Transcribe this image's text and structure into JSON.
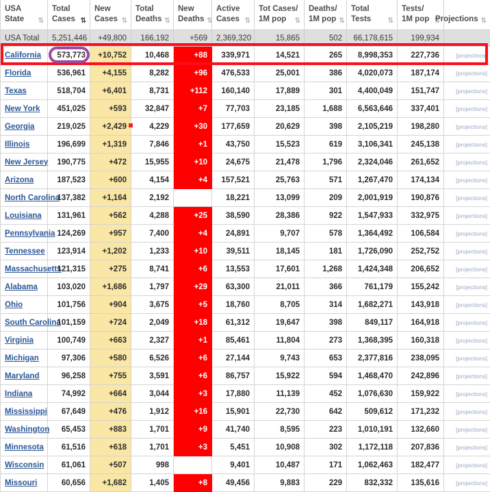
{
  "table": {
    "columns": [
      {
        "key": "state",
        "line1": "USA",
        "line2": "State",
        "sort_icon": "sort-both-icon",
        "sort_active": false
      },
      {
        "key": "totcases",
        "line1": "Total",
        "line2": "Cases",
        "sort_icon": "sort-desc-icon",
        "sort_active": true
      },
      {
        "key": "newcases",
        "line1": "New",
        "line2": "Cases",
        "sort_icon": "sort-both-icon",
        "sort_active": false
      },
      {
        "key": "totdeaths",
        "line1": "Total",
        "line2": "Deaths",
        "sort_icon": "sort-both-icon",
        "sort_active": false
      },
      {
        "key": "newdeaths",
        "line1": "New",
        "line2": "Deaths",
        "sort_icon": "sort-both-icon",
        "sort_active": false
      },
      {
        "key": "active",
        "line1": "Active",
        "line2": "Cases",
        "sort_icon": "sort-both-icon",
        "sort_active": false
      },
      {
        "key": "cases1m",
        "line1": "Tot Cases/",
        "line2": "1M pop",
        "sort_icon": "sort-both-icon",
        "sort_active": false
      },
      {
        "key": "deaths1m",
        "line1": "Deaths/",
        "line2": "1M pop",
        "sort_icon": "sort-both-icon",
        "sort_active": false
      },
      {
        "key": "tottests",
        "line1": "Total",
        "line2": "Tests",
        "sort_icon": "sort-both-icon",
        "sort_active": false
      },
      {
        "key": "tests1m",
        "line1": "Tests/",
        "line2": "1M pop",
        "sort_icon": "sort-both-icon",
        "sort_active": false
      },
      {
        "key": "proj",
        "line1": "",
        "line2": "Projections",
        "sort_icon": "sort-both-icon",
        "sort_active": false
      }
    ],
    "projections_link_label": "[projections]",
    "total_row": {
      "state": "USA Total",
      "totcases": "5,251,446",
      "newcases": "+49,800",
      "totdeaths": "166,192",
      "newdeaths": "+569",
      "active": "2,369,320",
      "cases1m": "15,865",
      "deaths1m": "502",
      "tottests": "66,178,615",
      "tests1m": "199,934",
      "proj": ""
    },
    "rows": [
      {
        "state": "California",
        "totcases": "573,773",
        "newcases": "+10,752",
        "totdeaths": "10,468",
        "newdeaths": "+88",
        "active": "339,971",
        "cases1m": "14,521",
        "deaths1m": "265",
        "tottests": "8,998,353",
        "tests1m": "227,736",
        "proj": "[projections]"
      },
      {
        "state": "Florida",
        "totcases": "536,961",
        "newcases": "+4,155",
        "totdeaths": "8,282",
        "newdeaths": "+96",
        "active": "476,533",
        "cases1m": "25,001",
        "deaths1m": "386",
        "tottests": "4,020,073",
        "tests1m": "187,174",
        "proj": "[projections]"
      },
      {
        "state": "Texas",
        "totcases": "518,704",
        "newcases": "+6,401",
        "totdeaths": "8,731",
        "newdeaths": "+112",
        "active": "160,140",
        "cases1m": "17,889",
        "deaths1m": "301",
        "tottests": "4,400,049",
        "tests1m": "151,747",
        "proj": "[projections]"
      },
      {
        "state": "New York",
        "totcases": "451,025",
        "newcases": "+593",
        "totdeaths": "32,847",
        "newdeaths": "+7",
        "active": "77,703",
        "cases1m": "23,185",
        "deaths1m": "1,688",
        "tottests": "6,563,646",
        "tests1m": "337,401",
        "proj": "[projections]"
      },
      {
        "state": "Georgia",
        "totcases": "219,025",
        "newcases": "+2,429",
        "totdeaths": "4,229",
        "newdeaths": "+30",
        "active": "177,659",
        "cases1m": "20,629",
        "deaths1m": "398",
        "tottests": "2,105,219",
        "tests1m": "198,280",
        "proj": "[projections]"
      },
      {
        "state": "Illinois",
        "totcases": "196,699",
        "newcases": "+1,319",
        "totdeaths": "7,846",
        "newdeaths": "+1",
        "active": "43,750",
        "cases1m": "15,523",
        "deaths1m": "619",
        "tottests": "3,106,341",
        "tests1m": "245,138",
        "proj": "[projections]"
      },
      {
        "state": "New Jersey",
        "totcases": "190,775",
        "newcases": "+472",
        "totdeaths": "15,955",
        "newdeaths": "+10",
        "active": "24,675",
        "cases1m": "21,478",
        "deaths1m": "1,796",
        "tottests": "2,324,046",
        "tests1m": "261,652",
        "proj": "[projections]"
      },
      {
        "state": "Arizona",
        "totcases": "187,523",
        "newcases": "+600",
        "totdeaths": "4,154",
        "newdeaths": "+4",
        "active": "157,521",
        "cases1m": "25,763",
        "deaths1m": "571",
        "tottests": "1,267,470",
        "tests1m": "174,134",
        "proj": "[projections]"
      },
      {
        "state": "North Carolina",
        "totcases": "137,382",
        "newcases": "+1,164",
        "totdeaths": "2,192",
        "newdeaths": "",
        "active": "18,221",
        "cases1m": "13,099",
        "deaths1m": "209",
        "tottests": "2,001,919",
        "tests1m": "190,876",
        "proj": "[projections]"
      },
      {
        "state": "Louisiana",
        "totcases": "131,961",
        "newcases": "+562",
        "totdeaths": "4,288",
        "newdeaths": "+25",
        "active": "38,590",
        "cases1m": "28,386",
        "deaths1m": "922",
        "tottests": "1,547,933",
        "tests1m": "332,975",
        "proj": "[projections]"
      },
      {
        "state": "Pennsylvania",
        "totcases": "124,269",
        "newcases": "+957",
        "totdeaths": "7,400",
        "newdeaths": "+4",
        "active": "24,891",
        "cases1m": "9,707",
        "deaths1m": "578",
        "tottests": "1,364,492",
        "tests1m": "106,584",
        "proj": "[projections]"
      },
      {
        "state": "Tennessee",
        "totcases": "123,914",
        "newcases": "+1,202",
        "totdeaths": "1,233",
        "newdeaths": "+10",
        "active": "39,511",
        "cases1m": "18,145",
        "deaths1m": "181",
        "tottests": "1,726,090",
        "tests1m": "252,752",
        "proj": "[projections]"
      },
      {
        "state": "Massachusetts",
        "totcases": "121,315",
        "newcases": "+275",
        "totdeaths": "8,741",
        "newdeaths": "+6",
        "active": "13,553",
        "cases1m": "17,601",
        "deaths1m": "1,268",
        "tottests": "1,424,348",
        "tests1m": "206,652",
        "proj": "[projections]"
      },
      {
        "state": "Alabama",
        "totcases": "103,020",
        "newcases": "+1,686",
        "totdeaths": "1,797",
        "newdeaths": "+29",
        "active": "63,300",
        "cases1m": "21,011",
        "deaths1m": "366",
        "tottests": "761,179",
        "tests1m": "155,242",
        "proj": "[projections]"
      },
      {
        "state": "Ohio",
        "totcases": "101,756",
        "newcases": "+904",
        "totdeaths": "3,675",
        "newdeaths": "+5",
        "active": "18,760",
        "cases1m": "8,705",
        "deaths1m": "314",
        "tottests": "1,682,271",
        "tests1m": "143,918",
        "proj": "[projections]"
      },
      {
        "state": "South Carolina",
        "totcases": "101,159",
        "newcases": "+724",
        "totdeaths": "2,049",
        "newdeaths": "+18",
        "active": "61,312",
        "cases1m": "19,647",
        "deaths1m": "398",
        "tottests": "849,117",
        "tests1m": "164,918",
        "proj": "[projections]"
      },
      {
        "state": "Virginia",
        "totcases": "100,749",
        "newcases": "+663",
        "totdeaths": "2,327",
        "newdeaths": "+1",
        "active": "85,461",
        "cases1m": "11,804",
        "deaths1m": "273",
        "tottests": "1,368,395",
        "tests1m": "160,318",
        "proj": "[projections]"
      },
      {
        "state": "Michigan",
        "totcases": "97,306",
        "newcases": "+580",
        "totdeaths": "6,526",
        "newdeaths": "+6",
        "active": "27,144",
        "cases1m": "9,743",
        "deaths1m": "653",
        "tottests": "2,377,816",
        "tests1m": "238,095",
        "proj": "[projections]"
      },
      {
        "state": "Maryland",
        "totcases": "96,258",
        "newcases": "+755",
        "totdeaths": "3,591",
        "newdeaths": "+6",
        "active": "86,757",
        "cases1m": "15,922",
        "deaths1m": "594",
        "tottests": "1,468,470",
        "tests1m": "242,896",
        "proj": "[projections]"
      },
      {
        "state": "Indiana",
        "totcases": "74,992",
        "newcases": "+664",
        "totdeaths": "3,044",
        "newdeaths": "+3",
        "active": "17,880",
        "cases1m": "11,139",
        "deaths1m": "452",
        "tottests": "1,076,630",
        "tests1m": "159,922",
        "proj": "[projections]"
      },
      {
        "state": "Mississippi",
        "totcases": "67,649",
        "newcases": "+476",
        "totdeaths": "1,912",
        "newdeaths": "+16",
        "active": "15,901",
        "cases1m": "22,730",
        "deaths1m": "642",
        "tottests": "509,612",
        "tests1m": "171,232",
        "proj": "[projections]"
      },
      {
        "state": "Washington",
        "totcases": "65,453",
        "newcases": "+883",
        "totdeaths": "1,701",
        "newdeaths": "+9",
        "active": "41,740",
        "cases1m": "8,595",
        "deaths1m": "223",
        "tottests": "1,010,191",
        "tests1m": "132,660",
        "proj": "[projections]"
      },
      {
        "state": "Minnesota",
        "totcases": "61,516",
        "newcases": "+618",
        "totdeaths": "1,701",
        "newdeaths": "+3",
        "active": "5,451",
        "cases1m": "10,908",
        "deaths1m": "302",
        "tottests": "1,172,118",
        "tests1m": "207,836",
        "proj": "[projections]"
      },
      {
        "state": "Wisconsin",
        "totcases": "61,061",
        "newcases": "+507",
        "totdeaths": "998",
        "newdeaths": "",
        "active": "9,401",
        "cases1m": "10,487",
        "deaths1m": "171",
        "tottests": "1,062,463",
        "tests1m": "182,477",
        "proj": "[projections]"
      },
      {
        "state": "Missouri",
        "totcases": "60,656",
        "newcases": "+1,682",
        "totdeaths": "1,405",
        "newdeaths": "+8",
        "active": "49,456",
        "cases1m": "9,883",
        "deaths1m": "229",
        "tottests": "832,332",
        "tests1m": "135,616",
        "proj": "[projections]"
      }
    ]
  },
  "annotations": {
    "row_highlight_box": {
      "target": "California",
      "color": "#fc0d1b",
      "shape": "rectangle"
    },
    "value_highlight_ellipse": {
      "target": "573,773",
      "color": "#9c4ca0",
      "shape": "rounded-rectangle"
    },
    "cursor_marker": {
      "color": "#ee2222"
    }
  },
  "colors": {
    "new_cases_bg": "#fae7a6",
    "new_deaths_bg": "#ff0000",
    "total_row_bg": "#dfdfdf",
    "link": "#2b5797",
    "projection_link": "#9aa8c4",
    "annotation_red": "#fc0d1b",
    "annotation_purple": "#9c4ca0"
  }
}
